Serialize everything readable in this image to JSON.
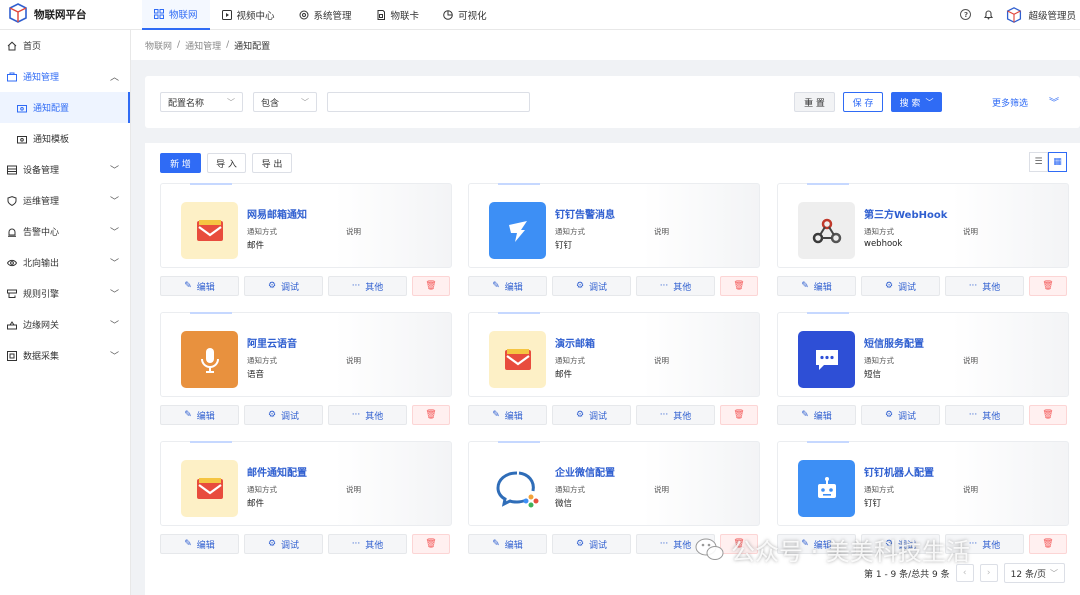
{
  "app": {
    "title": "物联网平台"
  },
  "topnav": [
    {
      "label": "物联网",
      "icon": "grid-icon",
      "active": true
    },
    {
      "label": "视频中心",
      "icon": "play-icon"
    },
    {
      "label": "系统管理",
      "icon": "gear-icon"
    },
    {
      "label": "物联卡",
      "icon": "sim-card-icon"
    },
    {
      "label": "可视化",
      "icon": "pie-icon"
    }
  ],
  "user": {
    "name": "超级管理员"
  },
  "sidebar": {
    "items": [
      {
        "label": "首页"
      },
      {
        "label": "通知管理"
      },
      {
        "label": "通知配置"
      },
      {
        "label": "通知模板"
      },
      {
        "label": "设备管理"
      },
      {
        "label": "运维管理"
      },
      {
        "label": "告警中心"
      },
      {
        "label": "北向输出"
      },
      {
        "label": "规则引擎"
      },
      {
        "label": "边缘网关"
      },
      {
        "label": "数据采集"
      }
    ]
  },
  "breadcrumb": {
    "items": [
      "物联网",
      "通知管理",
      "通知配置"
    ],
    "sep": "/"
  },
  "search": {
    "field": "配置名称",
    "operator": "包含",
    "value": "",
    "reset": "重 置",
    "save": "保 存",
    "search": "搜 索",
    "more": "更多筛选"
  },
  "toolbar": {
    "new": "新 增",
    "import": "导 入",
    "export": "导 出"
  },
  "card_labels": {
    "method": "通知方式",
    "desc": "说明",
    "edit": "编辑",
    "debug": "调试",
    "other": "其他"
  },
  "cards": [
    {
      "title": "网易邮箱通知",
      "type": "邮件",
      "icon": "mail-icon",
      "bg": "#fdf0c6"
    },
    {
      "title": "钉钉告警消息",
      "type": "钉钉",
      "icon": "dingtalk-icon",
      "bg": "#3d8ff5"
    },
    {
      "title": "第三方WebHook",
      "type": "webhook",
      "icon": "webhook-icon",
      "bg": "#eeeeee"
    },
    {
      "title": "阿里云语音",
      "type": "语音",
      "icon": "microphone-icon",
      "bg": "#e8913e"
    },
    {
      "title": "演示邮箱",
      "type": "邮件",
      "icon": "mail-icon",
      "bg": "#fdf0c6"
    },
    {
      "title": "短信服务配置",
      "type": "短信",
      "icon": "sms-icon",
      "bg": "#2e4fd6"
    },
    {
      "title": "邮件通知配置",
      "type": "邮件",
      "icon": "mail-icon",
      "bg": "#fdf0c6"
    },
    {
      "title": "企业微信配置",
      "type": "微信",
      "icon": "wecom-icon",
      "bg": "#ffffff"
    },
    {
      "title": "钉钉机器人配置",
      "type": "钉钉",
      "icon": "robot-icon",
      "bg": "#3d8ff5"
    }
  ],
  "pagination": {
    "summary": "第 1 - 9 条/总共 9 条",
    "page_size": "12 条/页"
  },
  "watermark": {
    "text": "公众号 · 美美科技生活"
  },
  "colors": {
    "primary": "#2f6bf5",
    "danger": "#f45b5b"
  }
}
